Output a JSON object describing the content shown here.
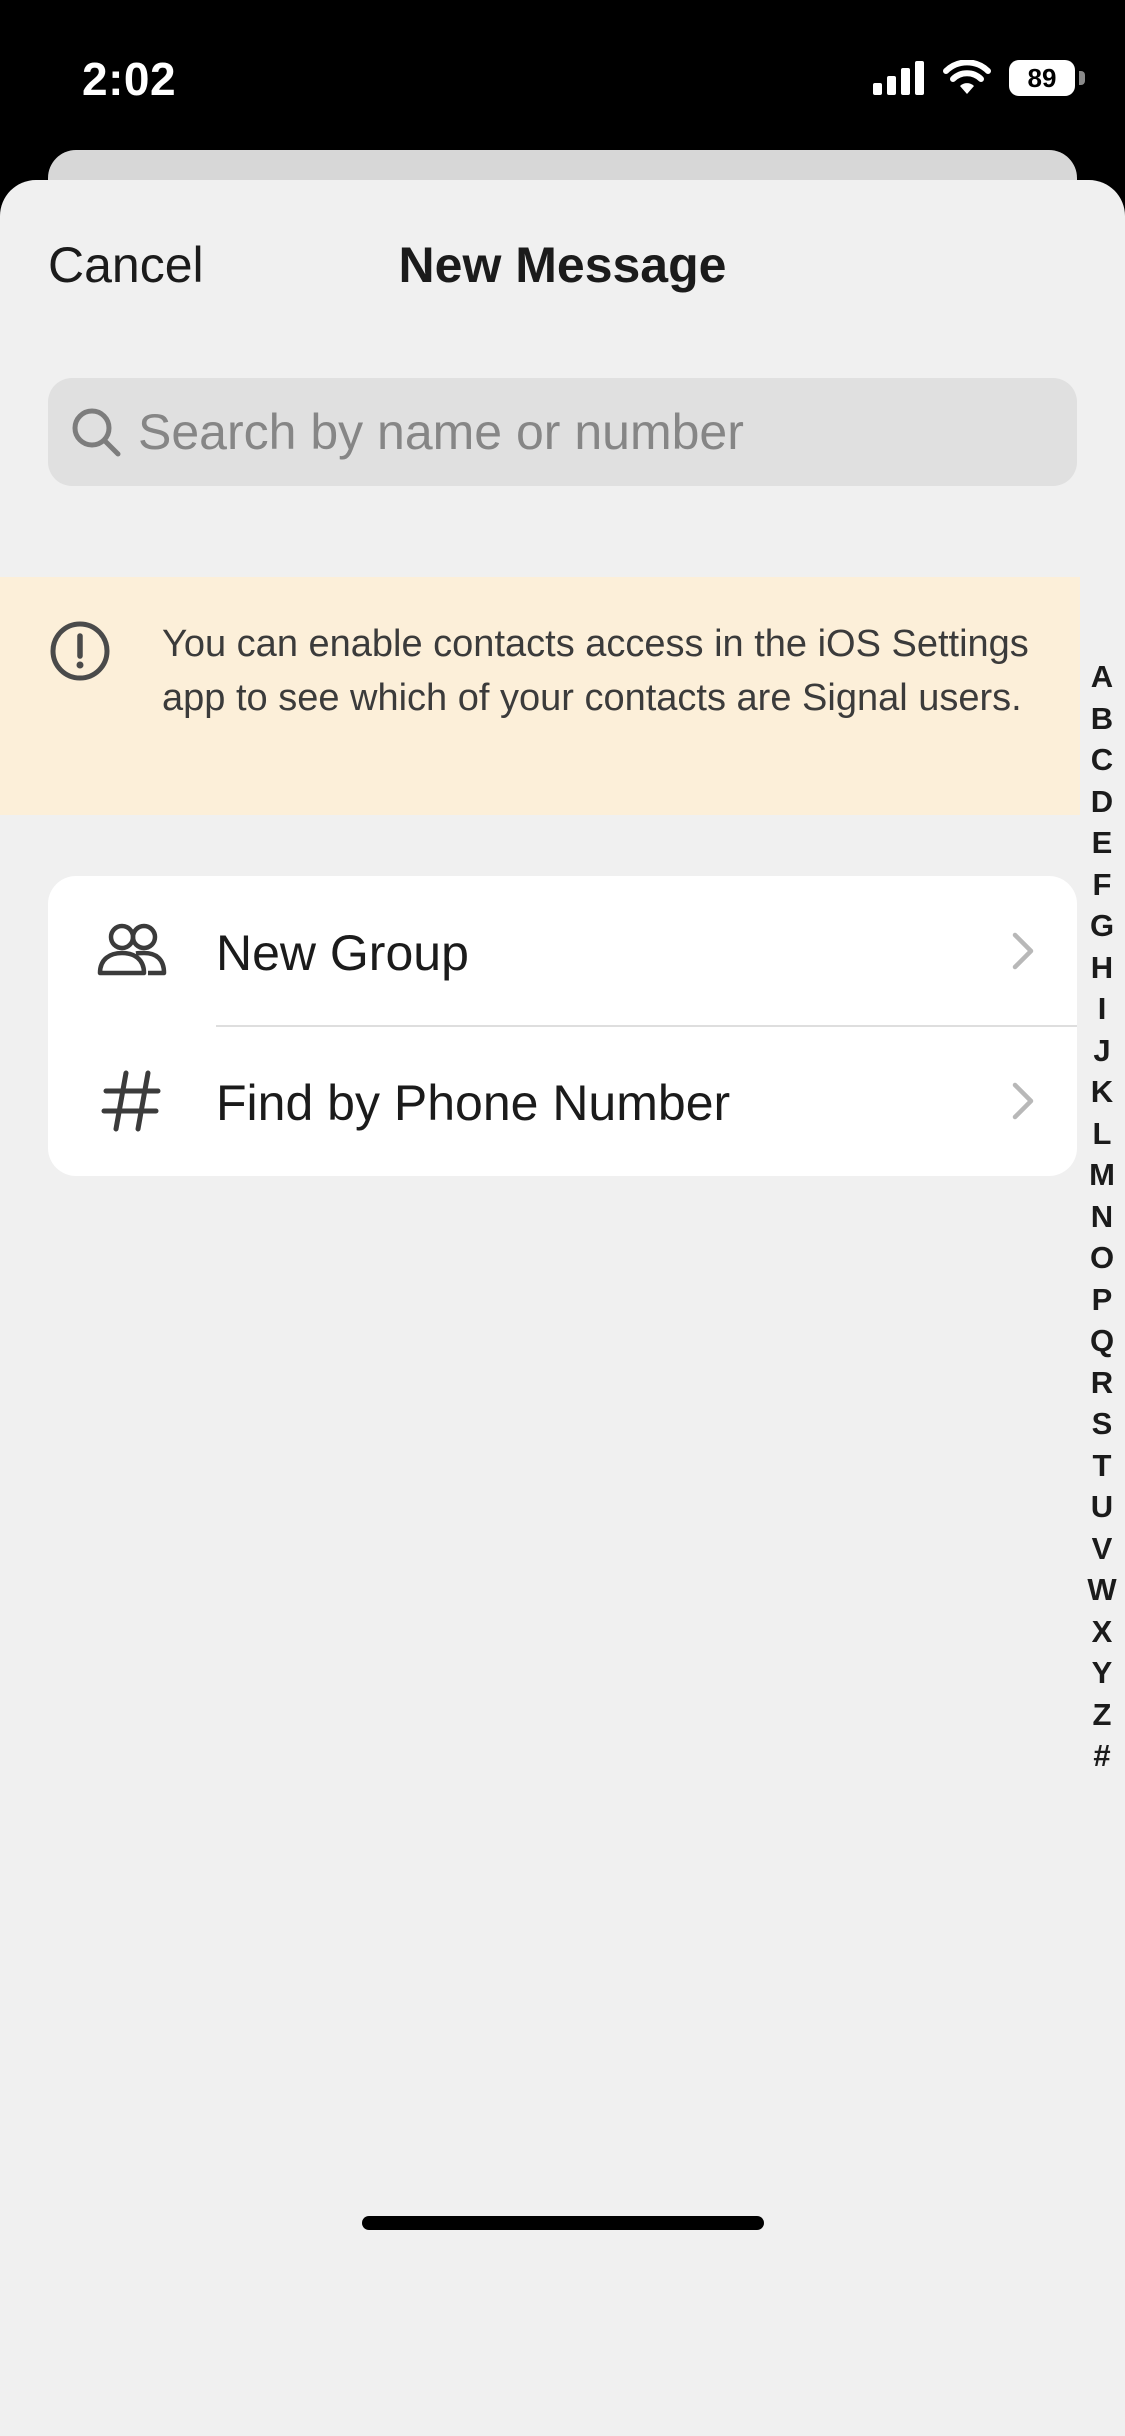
{
  "status_bar": {
    "time": "2:02",
    "battery": "89"
  },
  "nav": {
    "cancel_label": "Cancel",
    "title": "New Message"
  },
  "search": {
    "placeholder": "Search by name or number",
    "value": ""
  },
  "banner": {
    "icon": "exclamation-circle-icon",
    "text": "You can enable contacts access in the iOS Settings app to see which of your contacts are Signal users."
  },
  "actions": [
    {
      "icon": "group-icon",
      "label": "New Group"
    },
    {
      "icon": "hash-icon",
      "label": "Find by Phone Number"
    }
  ],
  "index_letters": [
    "A",
    "B",
    "C",
    "D",
    "E",
    "F",
    "G",
    "H",
    "I",
    "J",
    "K",
    "L",
    "M",
    "N",
    "O",
    "P",
    "Q",
    "R",
    "S",
    "T",
    "U",
    "V",
    "W",
    "X",
    "Y",
    "Z",
    "#"
  ],
  "colors": {
    "sheet_background": "#f0f0f0",
    "banner_background": "#fcefd9",
    "card_background": "#ffffff",
    "text_primary": "#1b1b1b",
    "placeholder": "#868686"
  }
}
